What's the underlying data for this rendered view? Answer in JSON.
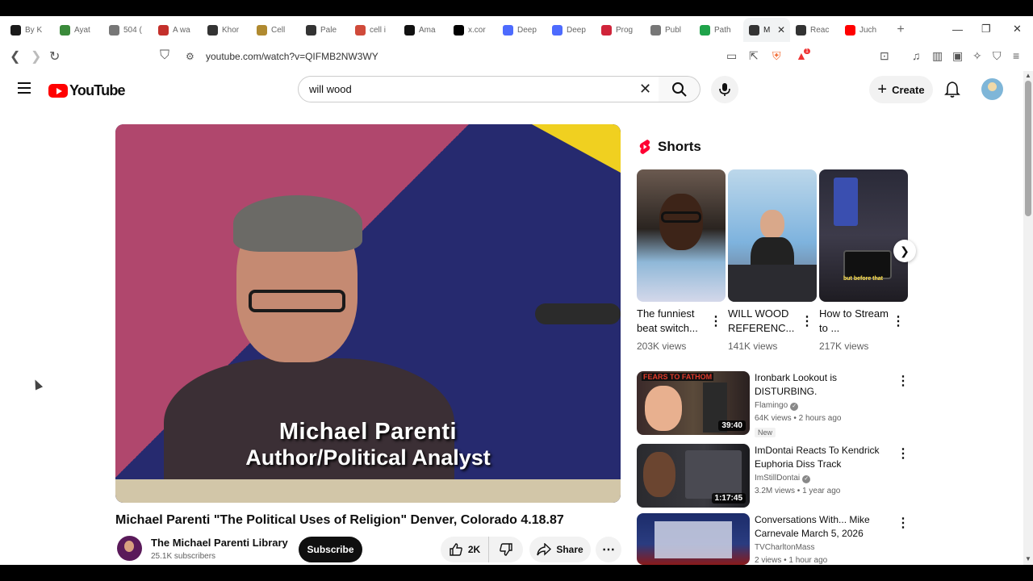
{
  "browser": {
    "tabs": [
      {
        "title": "By K",
        "color": "#1a1a1a"
      },
      {
        "title": "Ayat",
        "color": "#3a8a3a"
      },
      {
        "title": "504 (",
        "color": "#777777"
      },
      {
        "title": "A wa",
        "color": "#c4302b"
      },
      {
        "title": "Khor",
        "color": "#333333"
      },
      {
        "title": "Cell",
        "color": "#b08a30"
      },
      {
        "title": "Pale",
        "color": "#333333"
      },
      {
        "title": "cell i",
        "color": "#d04a3a"
      },
      {
        "title": "Ama",
        "color": "#111111"
      },
      {
        "title": "x.cor",
        "color": "#000000"
      },
      {
        "title": "Deep",
        "color": "#4d6bfe"
      },
      {
        "title": "Deep",
        "color": "#4d6bfe"
      },
      {
        "title": "Prog",
        "color": "#d0243a"
      },
      {
        "title": "Publ",
        "color": "#777777"
      },
      {
        "title": "Path",
        "color": "#1fa34a"
      },
      {
        "title": "M",
        "color": "#333333",
        "active": true
      },
      {
        "title": "Reac",
        "color": "#333333"
      },
      {
        "title": "Juch",
        "color": "#ff0000"
      }
    ],
    "url": "youtube.com/watch?v=QIFMB2NW3WY",
    "ext_badge_count": "1"
  },
  "youtube": {
    "search_value": "will wood",
    "create_label": "Create",
    "video": {
      "caption_name": "Michael Parenti",
      "caption_role": "Author/Political Analyst",
      "title": "Michael Parenti \"The Political Uses of Religion\" Denver, Colorado 4.18.87",
      "channel": "The Michael Parenti Library",
      "subscribers": "25.1K subscribers",
      "subscribe_label": "Subscribe",
      "likes": "2K",
      "share_label": "Share"
    },
    "shorts": {
      "heading": "Shorts",
      "items": [
        {
          "title": "The funniest beat switch...",
          "views": "203K views"
        },
        {
          "title": "WILL WOOD REFERENC...",
          "views": "141K views"
        },
        {
          "title": "How to Stream to ...",
          "views": "217K views"
        }
      ]
    },
    "recommendations": [
      {
        "title": "Ironbark Lookout is DISTURBING.",
        "channel": "Flamingo",
        "meta": "64K views • 2 hours ago",
        "badge": "New",
        "duration": "39:40",
        "thumb_text": "FEARS TO FATHOM"
      },
      {
        "title": "ImDontai Reacts To Kendrick Euphoria Diss Track",
        "channel": "ImStillDontai",
        "meta": "3.2M views • 1 year ago",
        "badge": "",
        "duration": "1:17:45"
      },
      {
        "title": "Conversations With... Mike Carnevale March 5, 2026",
        "channel": "TVCharltonMass",
        "meta": "2 views • 1 hour ago",
        "badge": "",
        "duration": ""
      }
    ]
  }
}
